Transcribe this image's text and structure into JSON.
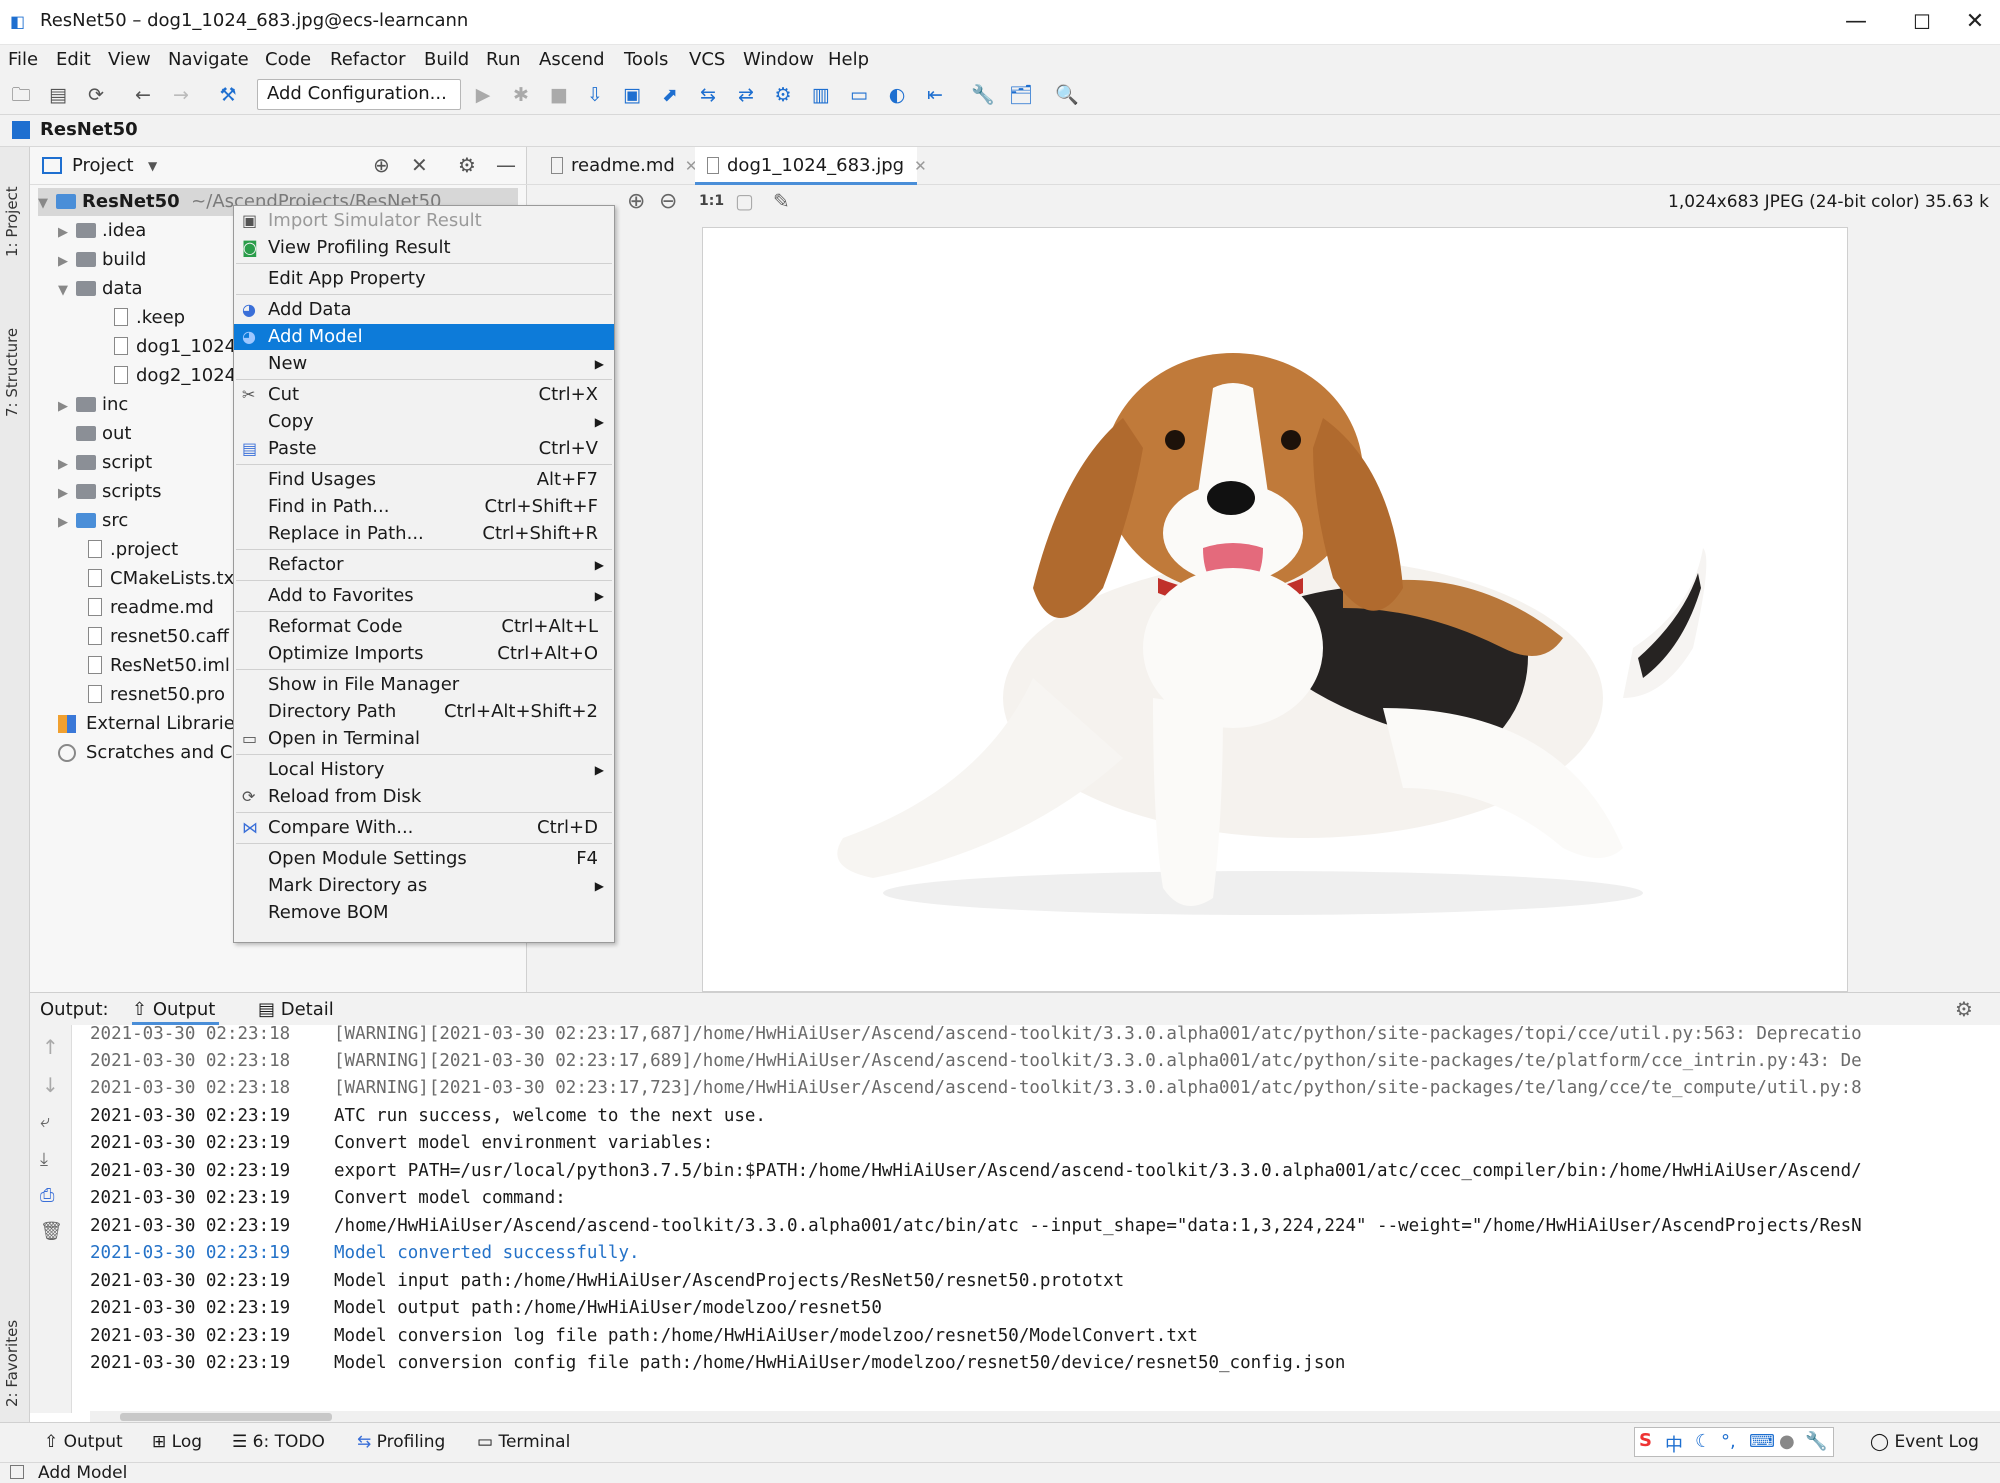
{
  "window": {
    "title": "ResNet50 – dog1_1024_683.jpg@ecs-learncann"
  },
  "menu": [
    "File",
    "Edit",
    "View",
    "Navigate",
    "Code",
    "Refactor",
    "Build",
    "Run",
    "Ascend",
    "Tools",
    "VCS",
    "Window",
    "Help"
  ],
  "toolbar": {
    "add_configuration": "Add Configuration..."
  },
  "navbar": {
    "project": "ResNet50"
  },
  "left_strip": {
    "project_tab": "1: Project",
    "structure_tab": "7: Structure",
    "favorites_tab": "2: Favorites"
  },
  "project_panel": {
    "title": "Project",
    "root_name": "ResNet50",
    "root_path": "~/AscendProjects/ResNet50",
    "items": [
      ".idea",
      "build",
      "data",
      ".keep",
      "dog1_1024",
      "dog2_1024",
      "inc",
      "out",
      "script",
      "scripts",
      "src",
      ".project",
      "CMakeLists.tx",
      "readme.md",
      "resnet50.caff",
      "ResNet50.iml",
      "resnet50.pro",
      "External Librarie",
      "Scratches and C"
    ]
  },
  "context_menu": {
    "items": [
      {
        "label": "Import Simulator Result",
        "shortcut": ""
      },
      {
        "label": "View Profiling Result",
        "shortcut": ""
      },
      {
        "label": "Edit App Property",
        "shortcut": ""
      },
      {
        "label": "Add Data",
        "shortcut": ""
      },
      {
        "label": "Add Model",
        "shortcut": ""
      },
      {
        "label": "New",
        "shortcut": ""
      },
      {
        "label": "Cut",
        "shortcut": "Ctrl+X"
      },
      {
        "label": "Copy",
        "shortcut": ""
      },
      {
        "label": "Paste",
        "shortcut": "Ctrl+V"
      },
      {
        "label": "Find Usages",
        "shortcut": "Alt+F7"
      },
      {
        "label": "Find in Path...",
        "shortcut": "Ctrl+Shift+F"
      },
      {
        "label": "Replace in Path...",
        "shortcut": "Ctrl+Shift+R"
      },
      {
        "label": "Refactor",
        "shortcut": ""
      },
      {
        "label": "Add to Favorites",
        "shortcut": ""
      },
      {
        "label": "Reformat Code",
        "shortcut": "Ctrl+Alt+L"
      },
      {
        "label": "Optimize Imports",
        "shortcut": "Ctrl+Alt+O"
      },
      {
        "label": "Show in File Manager",
        "shortcut": ""
      },
      {
        "label": "Directory Path",
        "shortcut": "Ctrl+Alt+Shift+2"
      },
      {
        "label": "Open in Terminal",
        "shortcut": ""
      },
      {
        "label": "Local History",
        "shortcut": ""
      },
      {
        "label": "Reload from Disk",
        "shortcut": ""
      },
      {
        "label": "Compare With...",
        "shortcut": "Ctrl+D"
      },
      {
        "label": "Open Module Settings",
        "shortcut": "F4"
      },
      {
        "label": "Mark Directory as",
        "shortcut": ""
      },
      {
        "label": "Remove BOM",
        "shortcut": ""
      }
    ]
  },
  "editor": {
    "tabs": [
      "readme.md",
      "dog1_1024_683.jpg"
    ],
    "zoom_actual": "1:1",
    "image_info": "1,024x683 JPEG (24-bit color) 35.63 k"
  },
  "output": {
    "label": "Output:",
    "tab_output": "Output",
    "tab_detail": "Detail",
    "lines": [
      {
        "ts": "2021-03-30 02:23:18",
        "msg": "[WARNING][2021-03-30 02:23:17,687]/home/HwHiAiUser/Ascend/ascend-toolkit/3.3.0.alpha001/atc/python/site-packages/topi/cce/util.py:563: Deprecatio"
      },
      {
        "ts": "2021-03-30 02:23:18",
        "msg": "[WARNING][2021-03-30 02:23:17,689]/home/HwHiAiUser/Ascend/ascend-toolkit/3.3.0.alpha001/atc/python/site-packages/te/platform/cce_intrin.py:43: De"
      },
      {
        "ts": "2021-03-30 02:23:18",
        "msg": "[WARNING][2021-03-30 02:23:17,723]/home/HwHiAiUser/Ascend/ascend-toolkit/3.3.0.alpha001/atc/python/site-packages/te/lang/cce/te_compute/util.py:8"
      },
      {
        "ts": "2021-03-30 02:23:19",
        "msg": "ATC run success, welcome to the next use."
      },
      {
        "ts": "2021-03-30 02:23:19",
        "msg": "Convert model environment variables:"
      },
      {
        "ts": "2021-03-30 02:23:19",
        "msg": "export PATH=/usr/local/python3.7.5/bin:$PATH:/home/HwHiAiUser/Ascend/ascend-toolkit/3.3.0.alpha001/atc/ccec_compiler/bin:/home/HwHiAiUser/Ascend/"
      },
      {
        "ts": "2021-03-30 02:23:19",
        "msg": "Convert model command:"
      },
      {
        "ts": "2021-03-30 02:23:19",
        "msg": "/home/HwHiAiUser/Ascend/ascend-toolkit/3.3.0.alpha001/atc/bin/atc --input_shape=\"data:1,3,224,224\" --weight=\"/home/HwHiAiUser/AscendProjects/ResN"
      },
      {
        "ts": "2021-03-30 02:23:19",
        "msg": "Model converted successfully."
      },
      {
        "ts": "2021-03-30 02:23:19",
        "msg": "Model input path:/home/HwHiAiUser/AscendProjects/ResNet50/resnet50.prototxt"
      },
      {
        "ts": "2021-03-30 02:23:19",
        "msg": "Model output path:/home/HwHiAiUser/modelzoo/resnet50"
      },
      {
        "ts": "2021-03-30 02:23:19",
        "msg": "Model conversion log file path:/home/HwHiAiUser/modelzoo/resnet50/ModelConvert.txt"
      },
      {
        "ts": "2021-03-30 02:23:19",
        "msg": "Model conversion config file path:/home/HwHiAiUser/modelzoo/resnet50/device/resnet50_config.json"
      }
    ]
  },
  "bottom_tabs": {
    "output": "Output",
    "log": "Log",
    "todo": "6: TODO",
    "profiling": "Profiling",
    "terminal": "Terminal",
    "event_log": "Event Log"
  },
  "ime": "中",
  "status": {
    "text": "Add Model"
  },
  "colors": {
    "selection": "#0d7bd9",
    "success_log": "#2472c8",
    "folder_blue": "#4a8ed8"
  }
}
